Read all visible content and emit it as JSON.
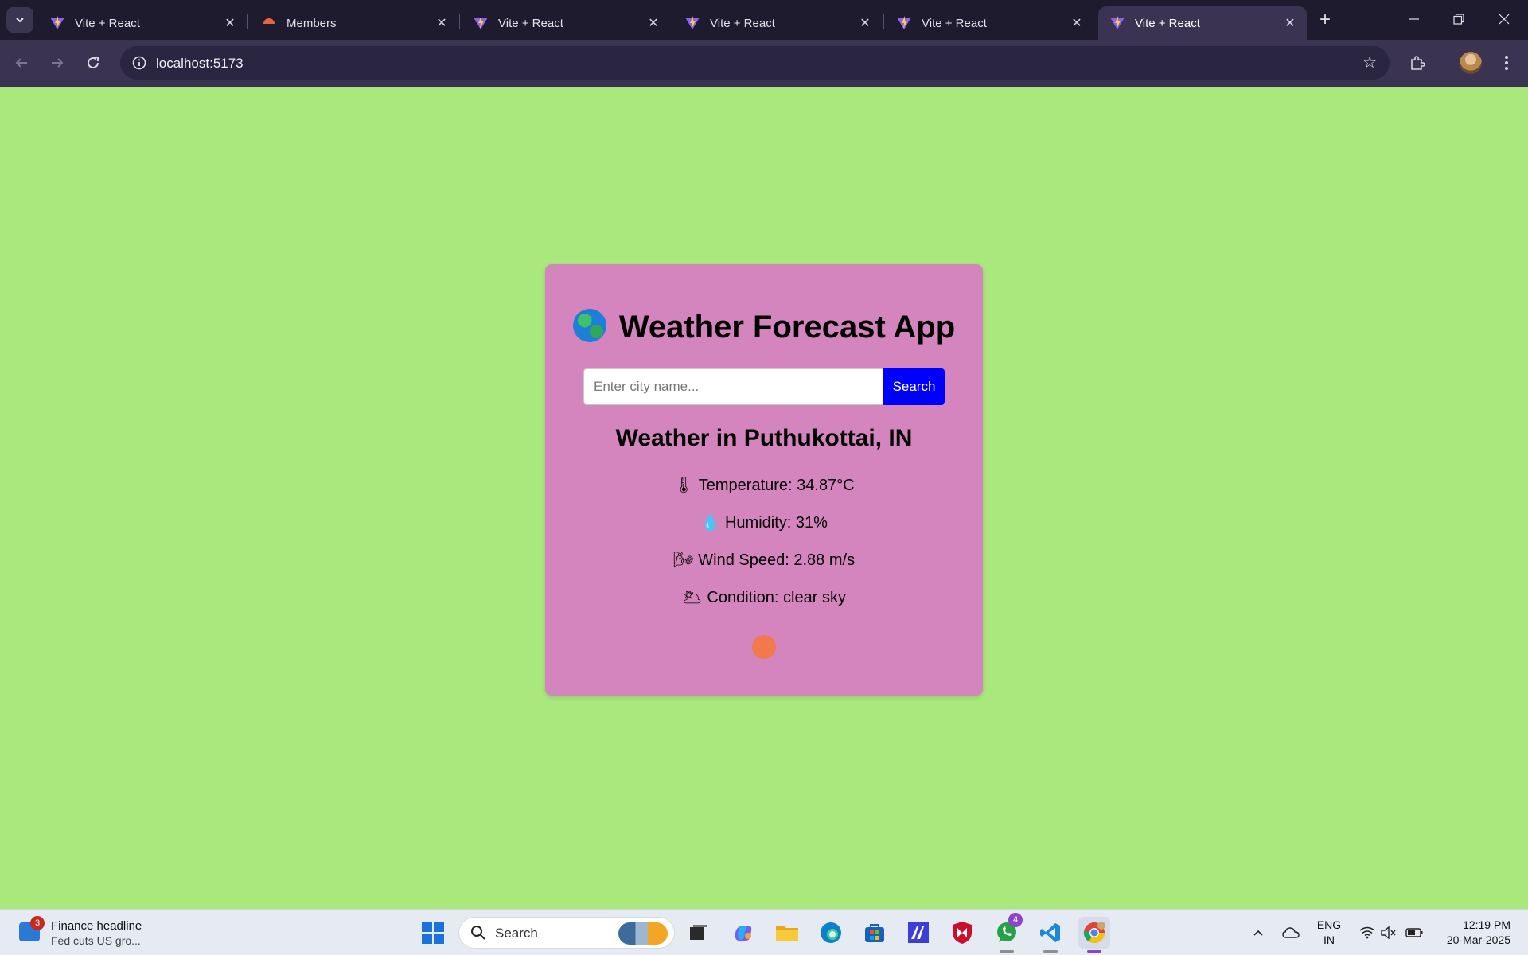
{
  "browser": {
    "tabs": [
      {
        "title": "Vite + React",
        "icon": "vite-logo"
      },
      {
        "title": "Members",
        "icon": "members-logo"
      },
      {
        "title": "Vite + React",
        "icon": "vite-logo"
      },
      {
        "title": "Vite + React",
        "icon": "vite-logo"
      },
      {
        "title": "Vite + React",
        "icon": "vite-logo"
      },
      {
        "title": "Vite + React",
        "icon": "vite-logo",
        "active": true
      }
    ],
    "url": "localhost:5173"
  },
  "app": {
    "title": "Weather Forecast App",
    "title_icon": "globe",
    "search": {
      "placeholder": "Enter city name...",
      "value": "",
      "button_label": "Search"
    },
    "result": {
      "heading": "Weather in Puthukottai, IN",
      "temperature": "Temperature: 34.87°C",
      "humidity": "Humidity: 31%",
      "wind": "Wind Speed: 2.88 m/s",
      "condition": "Condition: clear sky"
    },
    "colors": {
      "page_bg": "#a8e87c",
      "card_bg": "#d585bd",
      "button_bg": "#0000ff",
      "dot": "#f07a4c"
    }
  },
  "taskbar": {
    "widget": {
      "badge": "3",
      "title": "Finance headline",
      "subtitle": "Fed cuts US gro..."
    },
    "search_label": "Search",
    "whatsapp_badge": "4",
    "language": {
      "line1": "ENG",
      "line2": "IN"
    },
    "clock": {
      "time": "12:19 PM",
      "date": "20-Mar-2025"
    }
  }
}
